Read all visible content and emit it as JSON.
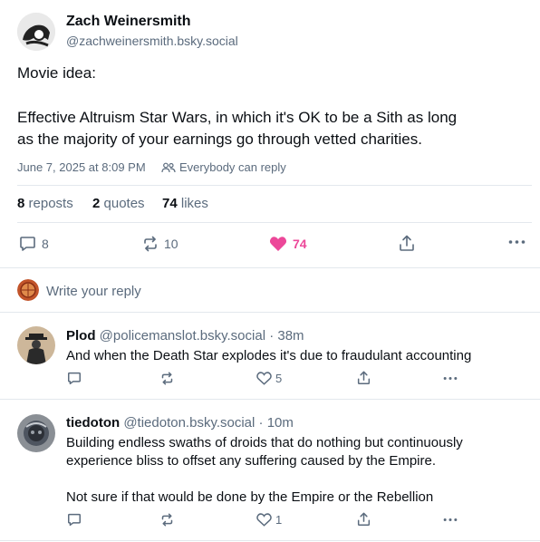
{
  "post": {
    "author_name": "Zach Weinersmith",
    "handle": "@zachweinersmith.bsky.social",
    "text_line1": "Movie idea:",
    "text_line2": "Effective Altruism Star Wars, in which it's OK to be a Sith as long",
    "text_line3": "as the majority of your earnings go through vetted charities.",
    "timestamp": "June 7, 2025 at 8:09 PM",
    "reply_setting": "Everybody can reply",
    "reposts_count": "8",
    "reposts_label": "reposts",
    "quotes_count": "2",
    "quotes_label": "quotes",
    "likes_count": "74",
    "likes_label": "likes",
    "actions": {
      "reply_count": "8",
      "repost_count": "10",
      "like_count": "74"
    }
  },
  "composer": {
    "placeholder": "Write your reply"
  },
  "replies": [
    {
      "name": "Plod",
      "handle": "@policemanslot.bsky.social",
      "time": "· 38m",
      "lines": [
        "And when the Death Star explodes it's due to fraudulant accounting"
      ],
      "like_count": "5"
    },
    {
      "name": "tiedoton",
      "handle": "@tiedoton.bsky.social",
      "time": "· 10m",
      "line1": "Building endless swaths of droids that do nothing but continuously",
      "line2": "experience bliss to offset any suffering caused by the Empire.",
      "line3": "Not sure if that would be done by the Empire or the Rebellion",
      "like_count": "1"
    }
  ],
  "colors": {
    "like_active": "#ec4899",
    "muted": "#5b6b7d",
    "divider": "#e3e8ed"
  }
}
